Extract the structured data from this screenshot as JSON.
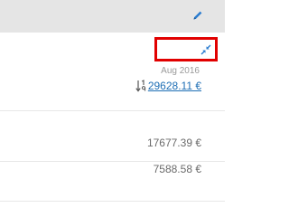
{
  "header": {
    "edit_icon": "pencil-icon",
    "accent_color": "#2a7ccf"
  },
  "toolbar": {
    "collapse_icon": "collapse-arrows-icon",
    "highlight_color": "#e10000"
  },
  "column": {
    "period_label": "Aug 2016",
    "total": "29628.11 €",
    "sort_icon": "sort-numeric-icon"
  },
  "rows": [
    {
      "value": "17677.39 €"
    },
    {
      "value": "7588.58 €"
    }
  ]
}
